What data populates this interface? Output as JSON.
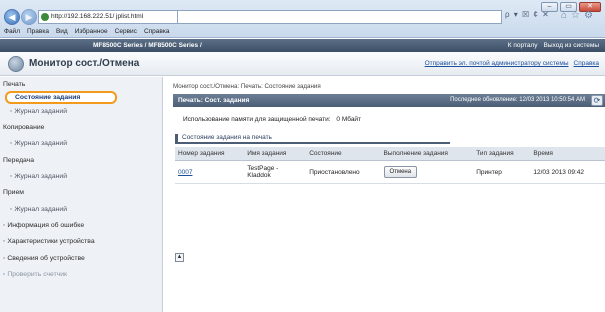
{
  "browser": {
    "address": "http://192.168.222.51/ jplist.html",
    "address_tools": "ρ ▾ ☒ ¢ ✕",
    "window_controls": [
      "–",
      "▭",
      "✕"
    ],
    "menu": [
      "Файл",
      "Правка",
      "Вид",
      "Избранное",
      "Сервис",
      "Справка"
    ]
  },
  "header": {
    "model": "MF8500C Series / MF8500C Series /",
    "links": [
      "К порталу",
      "Выход из системы"
    ]
  },
  "title": {
    "text": "Монитор сост./Отмена",
    "links": [
      "Отправить эл. почтой администратору системы",
      "Справка"
    ]
  },
  "sidebar": {
    "print": "Печать",
    "job_status": "Состояние задания",
    "job_log_1": "Журнал заданий",
    "copy": "Копирование",
    "job_log_2": "Журнал заданий",
    "send": "Передача",
    "job_log_3": "Журнал заданий",
    "receive": "Прием",
    "job_log_4": "Журнал заданий",
    "error_info": "Информация об ошибке",
    "device_specs": "Характеристики устройства",
    "device_info": "Сведения об устройстве",
    "check_counter": "Проверить счетчик"
  },
  "main": {
    "breadcrumb": "Монитор сост./Отмена: Печать: Состояние задания",
    "bar_left": "Печать: Сост. задания",
    "bar_right": "Последнее обновление: 12/03 2013 10:50:54 AM",
    "memory_label": "Использование памяти для защищенной печати:",
    "memory_value": "0 Мбайт",
    "section_title": "Состояние задания на печать",
    "columns": [
      "Номер задания",
      "Имя задания",
      "Состояние",
      "Выполнение задания",
      "Тип задания",
      "Время"
    ],
    "rows": [
      {
        "number": "0007",
        "name": "TestPage - Kladdok",
        "state": "Приостановлено",
        "action": "Отмена",
        "type": "Принтер",
        "time": "12/03 2013 09:42"
      }
    ]
  }
}
